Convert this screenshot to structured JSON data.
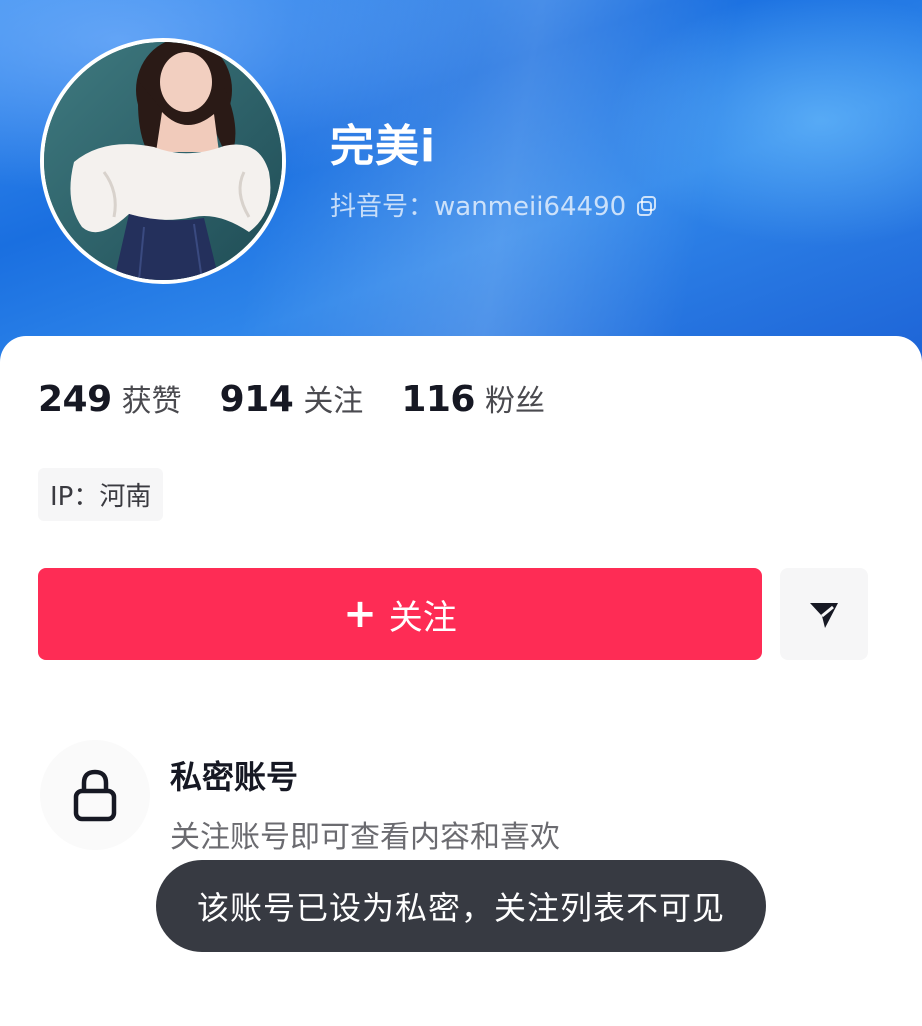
{
  "profile": {
    "username": "完美i",
    "douyin_id": "抖音号：wanmeii64490",
    "avatar": "profile-photo"
  },
  "stats": [
    {
      "value": "249",
      "label": "获赞"
    },
    {
      "value": "914",
      "label": "关注"
    },
    {
      "value": "116",
      "label": "粉丝"
    }
  ],
  "ip_location": "IP：河南",
  "actions": {
    "follow_plus": "+",
    "follow_label": "关注",
    "share_icon": "send-arrow-icon"
  },
  "private_account": {
    "title": "私密账号",
    "description": "关注账号即可查看内容和喜欢",
    "icon": "lock-icon"
  },
  "toast": {
    "message": "该账号已设为私密，关注列表不可见"
  },
  "colors": {
    "banner": "#1a6fe0",
    "follow_button": "#fe2c55",
    "toast_bg": "#373a42",
    "text_primary": "#161823"
  }
}
